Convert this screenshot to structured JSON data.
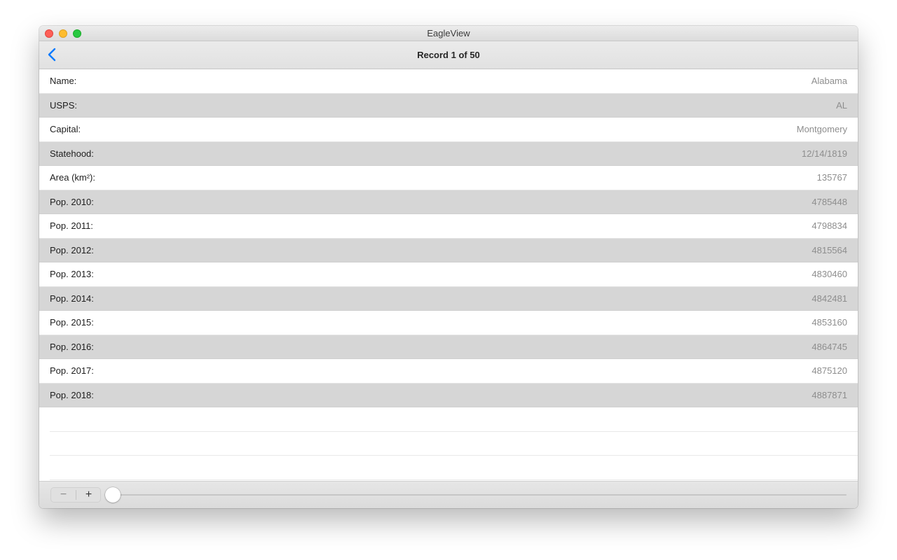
{
  "window": {
    "title": "EagleView"
  },
  "navbar": {
    "title": "Record 1 of 50",
    "back_icon": "chevron-left-icon",
    "accent_color": "#0a7aff"
  },
  "record": {
    "fields": [
      {
        "label": "Name:",
        "value": "Alabama"
      },
      {
        "label": "USPS:",
        "value": "AL"
      },
      {
        "label": "Capital:",
        "value": "Montgomery"
      },
      {
        "label": "Statehood:",
        "value": "12/14/1819"
      },
      {
        "label": "Area (km²):",
        "value": "135767"
      },
      {
        "label": "Pop. 2010:",
        "value": "4785448"
      },
      {
        "label": "Pop. 2011:",
        "value": "4798834"
      },
      {
        "label": "Pop. 2012:",
        "value": "4815564"
      },
      {
        "label": "Pop. 2013:",
        "value": "4830460"
      },
      {
        "label": "Pop. 2014:",
        "value": "4842481"
      },
      {
        "label": "Pop. 2015:",
        "value": "4853160"
      },
      {
        "label": "Pop. 2016:",
        "value": "4864745"
      },
      {
        "label": "Pop. 2017:",
        "value": "4875120"
      },
      {
        "label": "Pop. 2018:",
        "value": "4887871"
      }
    ]
  },
  "toolbar": {
    "minus_label": "−",
    "plus_label": "+",
    "slider": {
      "position_fraction": 0.0
    }
  }
}
